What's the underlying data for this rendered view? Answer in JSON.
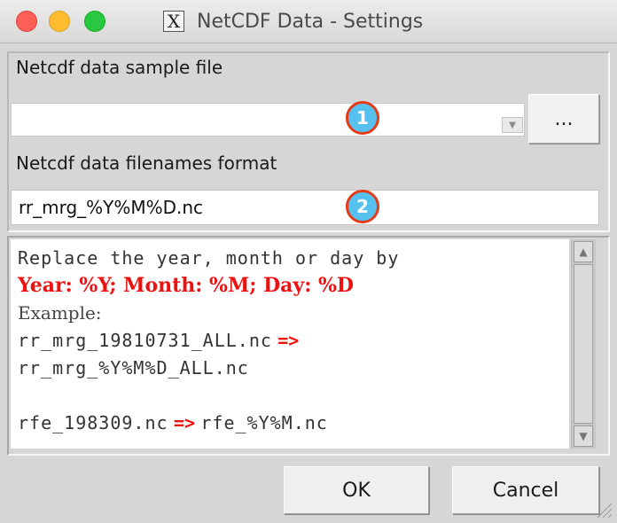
{
  "window": {
    "title": "NetCDF Data - Settings",
    "app_icon": "X"
  },
  "sample_file": {
    "label": "Netcdf data sample file",
    "value": "",
    "browse_label": "...",
    "badge": "1"
  },
  "filename_format": {
    "label": "Netcdf data filenames format",
    "value": "rr_mrg_%Y%M%D.nc",
    "badge": "2"
  },
  "help": {
    "line1": "Replace the year, month or day by",
    "line2": "Year: %Y; Month: %M; Day: %D",
    "line3": "Example:",
    "ex1_name": "rr_mrg_19810731_ALL.nc",
    "ex1_arrow": "=>",
    "ex1_format": "rr_mrg_%Y%M%D_ALL.nc",
    "ex2_name": "rfe_198309.nc",
    "ex2_arrow": "=>",
    "ex2_format": "rfe_%Y%M.nc"
  },
  "buttons": {
    "ok": "OK",
    "cancel": "Cancel"
  },
  "colors": {
    "badge_fill": "#56c1ee",
    "badge_border": "#e53b16",
    "highlight_red": "#ee1111"
  }
}
